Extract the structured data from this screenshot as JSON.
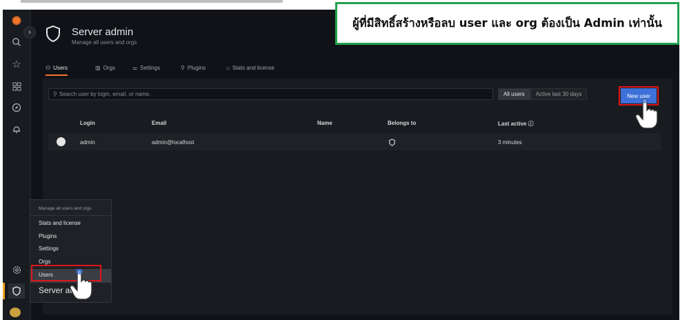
{
  "annotation": {
    "text": "ผู้ที่มีสิทธิ์สร้างหรือลบ user และ org ต้องเป็น Admin เท่านั้น"
  },
  "header": {
    "title": "Server admin",
    "subtitle": "Manage all users and orgs"
  },
  "tabs": [
    {
      "label": "Users",
      "active": true
    },
    {
      "label": "Orgs",
      "active": false
    },
    {
      "label": "Settings",
      "active": false
    },
    {
      "label": "Plugins",
      "active": false
    },
    {
      "label": "Stats and license",
      "active": false
    }
  ],
  "search": {
    "placeholder": "Search user by login, email, or name."
  },
  "filters": [
    {
      "label": "All users",
      "active": true
    },
    {
      "label": "Active last 30 days",
      "active": false
    }
  ],
  "new_user_label": "New user",
  "table": {
    "headers": [
      "Login",
      "Email",
      "Name",
      "Belongs to",
      "Last active"
    ],
    "rows": [
      {
        "login": "admin",
        "email": "admin@localhost",
        "name": "",
        "belongs_to": "shield-icon",
        "last_active": "3 minutes"
      }
    ]
  },
  "popup_menu": {
    "title": "Manage all users and orgs",
    "items": [
      "Stats and license",
      "Plugins",
      "Settings",
      "Orgs",
      "Users"
    ],
    "highlighted": "Users",
    "section_label": "Server admin",
    "section_label_visible": "Server ad"
  },
  "colors": {
    "accent": "#f2742b",
    "primary_button": "#3d71d9",
    "highlight_border": "#e0161a",
    "annotation_border": "#21a24d"
  },
  "nav_icons": [
    "grafana-logo-icon",
    "search-icon",
    "star-icon",
    "dashboards-icon",
    "explore-icon",
    "alerting-icon",
    "gear-icon",
    "shield-icon",
    "avatar-icon"
  ]
}
